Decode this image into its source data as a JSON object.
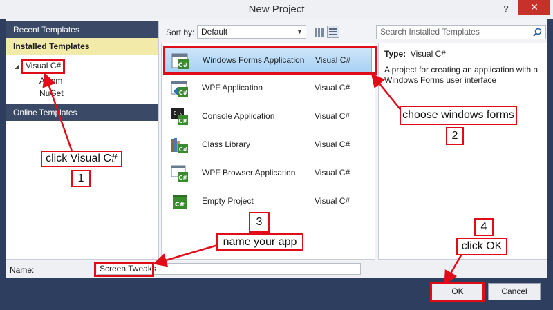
{
  "window": {
    "title": "New Project",
    "help": "?",
    "close": "✕"
  },
  "left_panel": {
    "recent": "Recent Templates",
    "installed": "Installed Templates",
    "tree": {
      "root": "Visual C#",
      "children": [
        "Axiom",
        "NuGet"
      ]
    },
    "online": "Online Templates"
  },
  "toolbar": {
    "sort_label": "Sort by:",
    "sort_value": "Default",
    "search_placeholder": "Search Installed Templates"
  },
  "templates": [
    {
      "name": "Windows Forms Application",
      "lang": "Visual C#",
      "icon": "winforms-icon"
    },
    {
      "name": "WPF Application",
      "lang": "Visual C#",
      "icon": "wpf-icon"
    },
    {
      "name": "Console Application",
      "lang": "Visual C#",
      "icon": "console-icon"
    },
    {
      "name": "Class Library",
      "lang": "Visual C#",
      "icon": "class-library-icon"
    },
    {
      "name": "WPF Browser Application",
      "lang": "Visual C#",
      "icon": "wpf-browser-icon"
    },
    {
      "name": "Empty Project",
      "lang": "Visual C#",
      "icon": "empty-project-icon"
    }
  ],
  "detail": {
    "type_label": "Type:",
    "type_value": "Visual C#",
    "description": "A project for creating an application with a Windows Forms user interface"
  },
  "name_row": {
    "label": "Name:",
    "value": "Screen Tweaks"
  },
  "buttons": {
    "ok": "OK",
    "cancel": "Cancel"
  },
  "annotations": {
    "step1": {
      "number": "1",
      "text": "click Visual C#"
    },
    "step2": {
      "number": "2",
      "text": "choose windows forms"
    },
    "step3": {
      "number": "3",
      "text": "name your app"
    },
    "step4": {
      "number": "4",
      "text": "click OK"
    }
  },
  "colors": {
    "annotation": "#e00c18",
    "frame": "#2d3e5e",
    "selected_category": "#f1eaa9"
  }
}
